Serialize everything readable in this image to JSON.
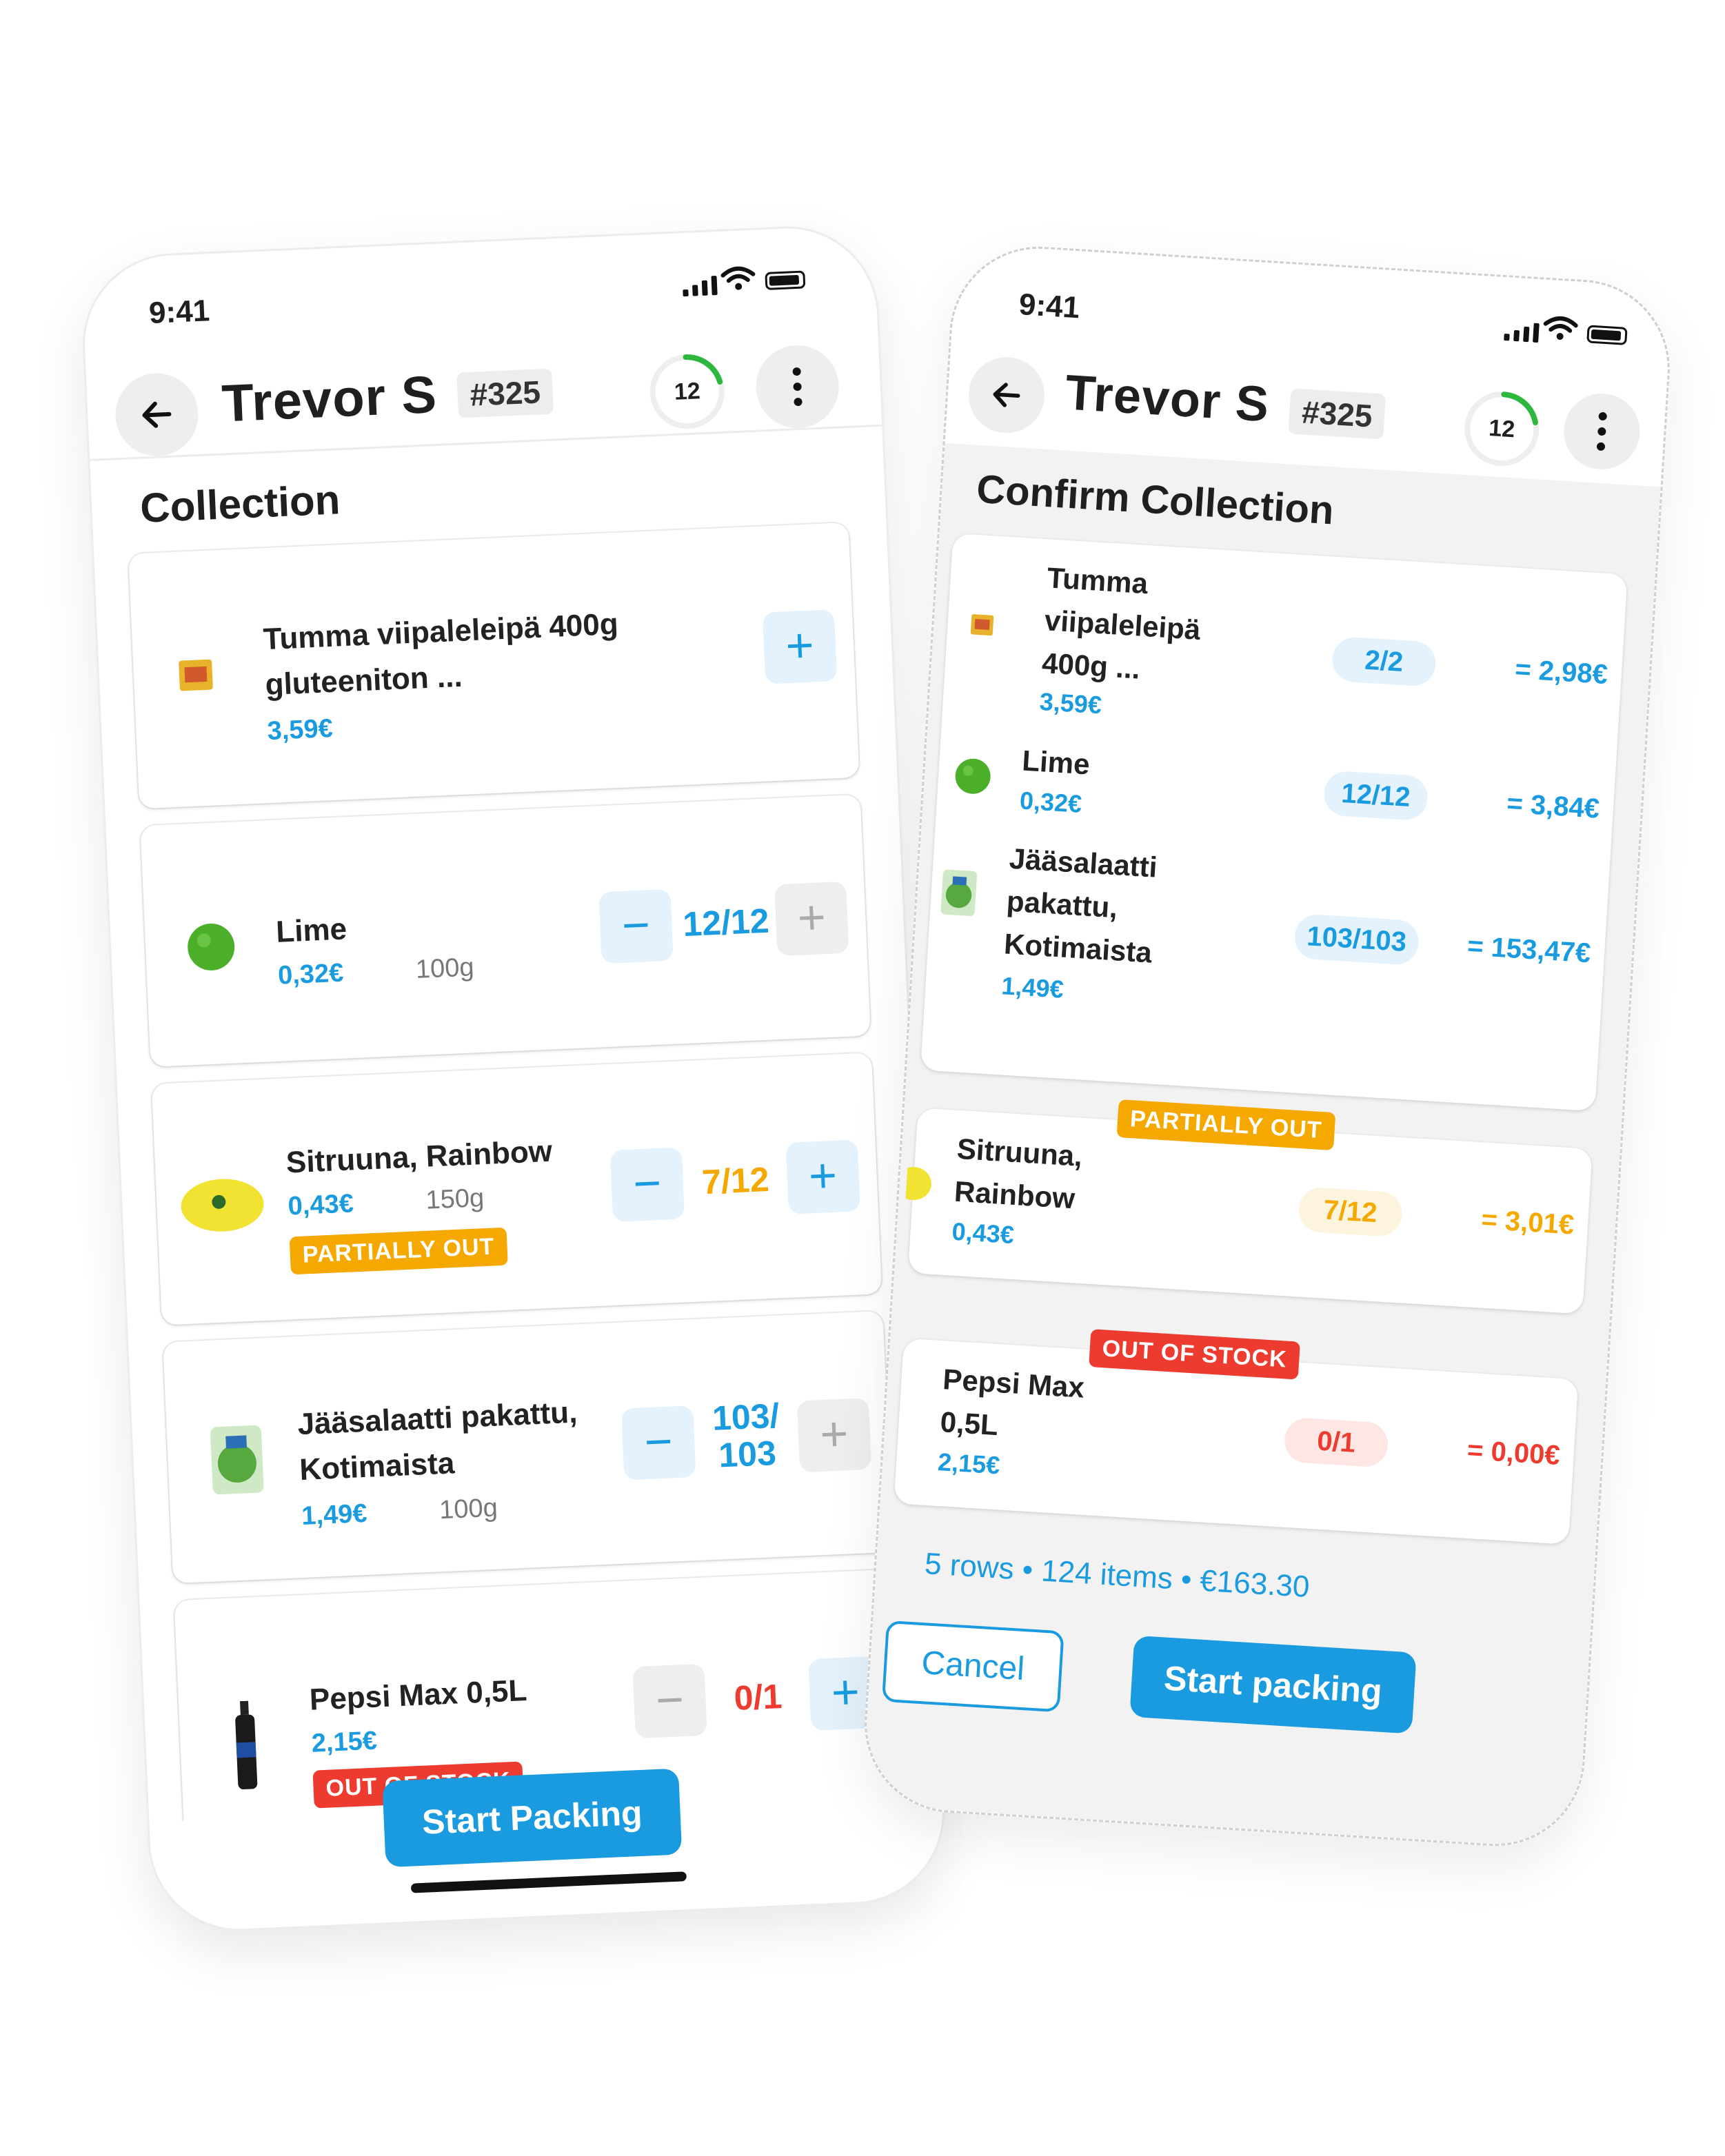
{
  "collection_screen": {
    "status_time": "9:41",
    "header": {
      "customer_name": "Trevor S",
      "order_number": "#325",
      "progress_count": "12"
    },
    "section_title": "Collection",
    "items": [
      {
        "name": "Tumma viipaleleipä 400g gluteeniton ...",
        "price": "3,59€",
        "weight": "",
        "qty": "",
        "badge": ""
      },
      {
        "name": "Lime",
        "price": "0,32€",
        "weight": "100g",
        "qty": "12/12",
        "badge": ""
      },
      {
        "name": "Sitruuna, Rainbow",
        "price": "0,43€",
        "weight": "150g",
        "qty": "7/12",
        "badge": "PARTIALLY OUT"
      },
      {
        "name_line1": "Jääsalaatti pakattu,",
        "name_line2": "Kotimaista",
        "price": "1,49€",
        "weight": "100g",
        "qty_line1": "103/",
        "qty_line2": "103",
        "badge": ""
      },
      {
        "name": "Pepsi Max 0,5L",
        "price": "2,15€",
        "weight": "",
        "qty": "0/1",
        "badge": "OUT OF STOCK"
      }
    ],
    "cta_label": "Start Packing"
  },
  "confirm_screen": {
    "status_time": "9:41",
    "header": {
      "customer_name": "Trevor S",
      "order_number": "#325",
      "progress_count": "12"
    },
    "section_title": "Confirm Collection",
    "items": [
      {
        "name_lines": [
          "Tumma",
          "viipaleleipä",
          "400g ..."
        ],
        "price": "3,59€",
        "qty": "2/2",
        "total": "= 2,98€"
      },
      {
        "name_lines": [
          "Lime"
        ],
        "price": "0,32€",
        "qty": "12/12",
        "total": "= 3,84€"
      },
      {
        "name_lines": [
          "Jääsalaatti",
          "pakattu,",
          "Kotimaista"
        ],
        "price": "1,49€",
        "qty": "103/103",
        "total": "= 153,47€"
      },
      {
        "name_lines": [
          "Sitruuna,",
          "Rainbow"
        ],
        "price": "0,43€",
        "qty": "7/12",
        "total": "= 3,01€",
        "badge": "PARTIALLY OUT"
      },
      {
        "name_lines": [
          "Pepsi Max",
          "0,5L"
        ],
        "price": "2,15€",
        "qty": "0/1",
        "total": "= 0,00€",
        "badge": "OUT OF STOCK"
      }
    ],
    "summary": "5 rows • 124 items • €163.30",
    "cancel_label": "Cancel",
    "cta_label": "Start packing"
  },
  "colors": {
    "accent": "#1a9be0",
    "warning": "#f5a800",
    "danger": "#ee3b2f",
    "progress_ring": "#2db83d"
  },
  "icons": [
    "back-arrow-icon",
    "more-vertical-icon",
    "plus-icon",
    "minus-icon",
    "cellular-signal-icon",
    "wifi-icon",
    "battery-icon"
  ]
}
